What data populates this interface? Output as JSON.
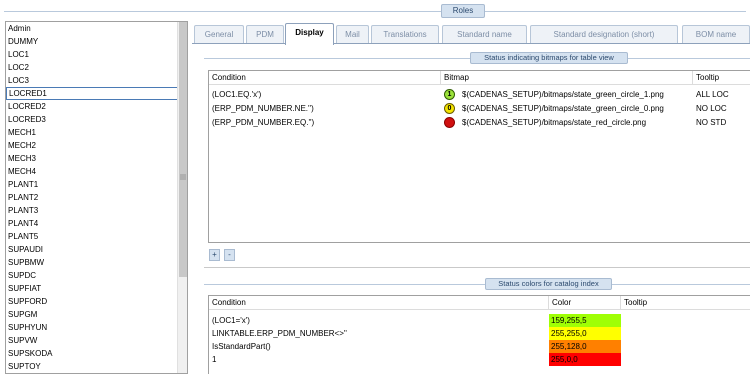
{
  "header": {
    "title": "Roles"
  },
  "roles": [
    "Admin",
    "DUMMY",
    "LOC1",
    "LOC2",
    "LOC3",
    "LOCRED1",
    "LOCRED2",
    "LOCRED3",
    "MECH1",
    "MECH2",
    "MECH3",
    "MECH4",
    "PLANT1",
    "PLANT2",
    "PLANT3",
    "PLANT4",
    "PLANT5",
    "SUPAUDI",
    "SUPBMW",
    "SUPDC",
    "SUPFIAT",
    "SUPFORD",
    "SUPGM",
    "SUPHYUN",
    "SUPVW",
    "SUPSKODA",
    "SUPTOY"
  ],
  "selected_role": "LOCRED1",
  "tabs": {
    "general": "General",
    "pdm": "PDM",
    "display": "Display",
    "mail": "Mail",
    "translations": "Translations",
    "standard_name": "Standard name",
    "standard_designation": "Standard designation (short)",
    "bom_name": "BOM name"
  },
  "active_tab": "Display",
  "bitmap_section": {
    "title": "Status indicating bitmaps for table view",
    "headers": {
      "condition": "Condition",
      "bitmap": "Bitmap",
      "tooltip": "Tooltip"
    },
    "rows": [
      {
        "condition": "(LOC1.EQ.'x')",
        "icon": "green-circle-1-icon",
        "icon_text": "1",
        "bitmap": "$(CADENAS_SETUP)/bitmaps/state_green_circle_1.png",
        "tooltip": "ALL LOC"
      },
      {
        "condition": "(ERP_PDM_NUMBER.NE.'')",
        "icon": "green-circle-0-icon",
        "icon_text": "0",
        "bitmap": "$(CADENAS_SETUP)/bitmaps/state_green_circle_0.png",
        "tooltip": "NO LOC"
      },
      {
        "condition": "(ERP_PDM_NUMBER.EQ.'')",
        "icon": "red-circle-icon",
        "icon_text": "",
        "bitmap": "$(CADENAS_SETUP)/bitmaps/state_red_circle.png",
        "tooltip": "NO STD"
      }
    ],
    "add_label": "+",
    "remove_label": "-"
  },
  "color_section": {
    "title": "Status colors for catalog index",
    "headers": {
      "condition": "Condition",
      "color": "Color",
      "tooltip": "Tooltip"
    },
    "rows": [
      {
        "condition": "(LOC1='x')",
        "color": "159,255,5",
        "hex": "#9fff05"
      },
      {
        "condition": "LINKTABLE.ERP_PDM_NUMBER<>''",
        "color": "255,255,0",
        "hex": "#ffff00"
      },
      {
        "condition": "IsStandardPart()",
        "color": "255,128,0",
        "hex": "#ff8000"
      },
      {
        "condition": "1",
        "color": "255,0,0",
        "hex": "#ff0000"
      }
    ]
  }
}
